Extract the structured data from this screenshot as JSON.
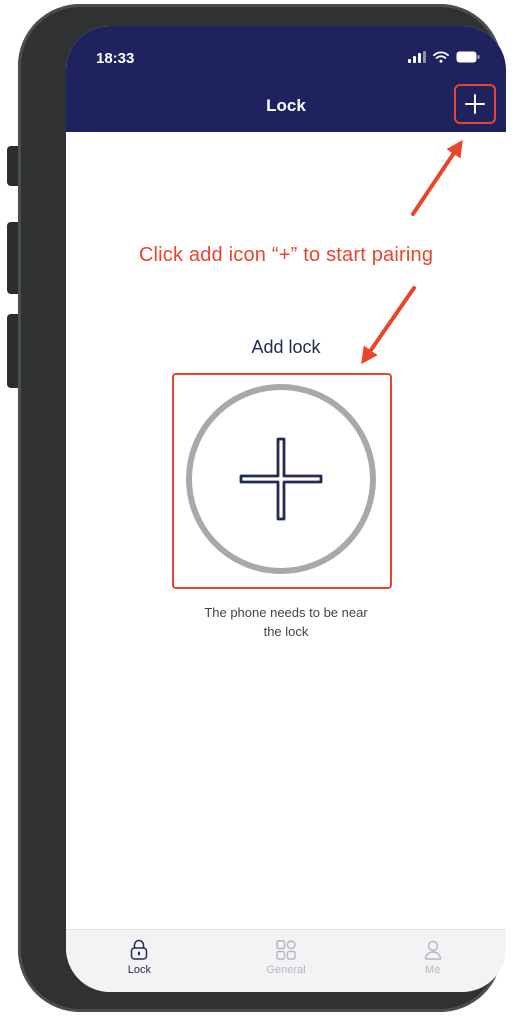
{
  "status_bar": {
    "time": "18:33"
  },
  "header": {
    "title": "Lock",
    "add_icon": "plus-icon"
  },
  "annotation": {
    "text": "Click add icon “+” to start pairing",
    "color": "#e8452c"
  },
  "main": {
    "add_lock_label": "Add lock",
    "add_lock_icon": "circle-plus-icon",
    "hint_line1": "The phone needs to be near",
    "hint_line2": "the lock"
  },
  "tabbar": {
    "tabs": [
      {
        "label": "Lock",
        "icon": "lock-icon",
        "active": true
      },
      {
        "label": "General",
        "icon": "grid-icon",
        "active": false
      },
      {
        "label": "Me",
        "icon": "person-icon",
        "active": false
      }
    ]
  },
  "colors": {
    "header_bg": "#1e2360",
    "accent_navy": "#222a55",
    "highlight_red": "#e8452c",
    "tab_inactive": "#b5b5bd"
  }
}
